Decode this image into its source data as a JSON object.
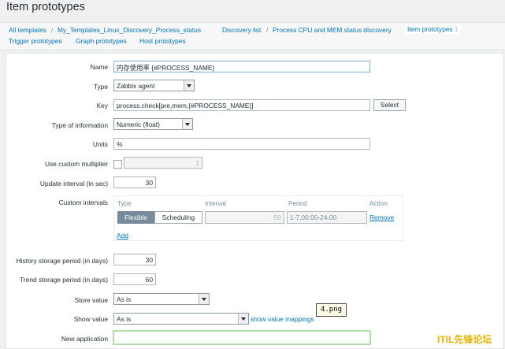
{
  "page": {
    "title": "Item prototypes"
  },
  "breadcrumbs": {
    "all_templates": "All templates",
    "separator": "/",
    "template": "My_Templates_Linux_Discovery_Process_status",
    "discovery_list": "Discovery list",
    "discovery_rule": "Process CPU and MEM status discovery",
    "item_prototypes": "Item prototypes",
    "item_prototypes_count": "1",
    "trigger_prototypes": "Trigger prototypes",
    "graph_prototypes": "Graph prototypes",
    "host_prototypes": "Host prototypes"
  },
  "form": {
    "name": {
      "label": "Name",
      "value": "内存使用率 {#PROCESS_NAME}"
    },
    "type": {
      "label": "Type",
      "value": "Zabbix agent"
    },
    "key": {
      "label": "Key",
      "value": "process.check[pre,mem,{#PROCESS_NAME}]",
      "button": "Select"
    },
    "type_of_information": {
      "label": "Type of information",
      "value": "Numeric (float)"
    },
    "units": {
      "label": "Units",
      "value": "%"
    },
    "custom_multiplier": {
      "label": "Use custom multiplier",
      "checked": false,
      "value": "1"
    },
    "update_interval": {
      "label": "Update interval (in sec)",
      "value": "30"
    },
    "custom_intervals": {
      "label": "Custom intervals",
      "headers": {
        "type": "Type",
        "interval": "Interval",
        "period": "Period",
        "action": "Action"
      },
      "row": {
        "flexible": "Flexible",
        "scheduling": "Scheduling",
        "interval": "50",
        "period": "1-7,00:00-24:00",
        "remove": "Remove"
      },
      "add": "Add"
    },
    "history": {
      "label": "History storage period (in days)",
      "value": "30"
    },
    "trend": {
      "label": "Trend storage period (in days)",
      "value": "60"
    },
    "store_value": {
      "label": "Store value",
      "value": "As is"
    },
    "show_value": {
      "label": "Show value",
      "value": "As is",
      "link": "show value mappings"
    },
    "new_application": {
      "label": "New application",
      "value": ""
    }
  },
  "overlays": {
    "badge": "4.png",
    "watermark": "ITIL先锋论坛"
  },
  "colors": {
    "link": "#0275b8",
    "accent_active": "#768d99",
    "focus_border": "#b8dbb0"
  }
}
